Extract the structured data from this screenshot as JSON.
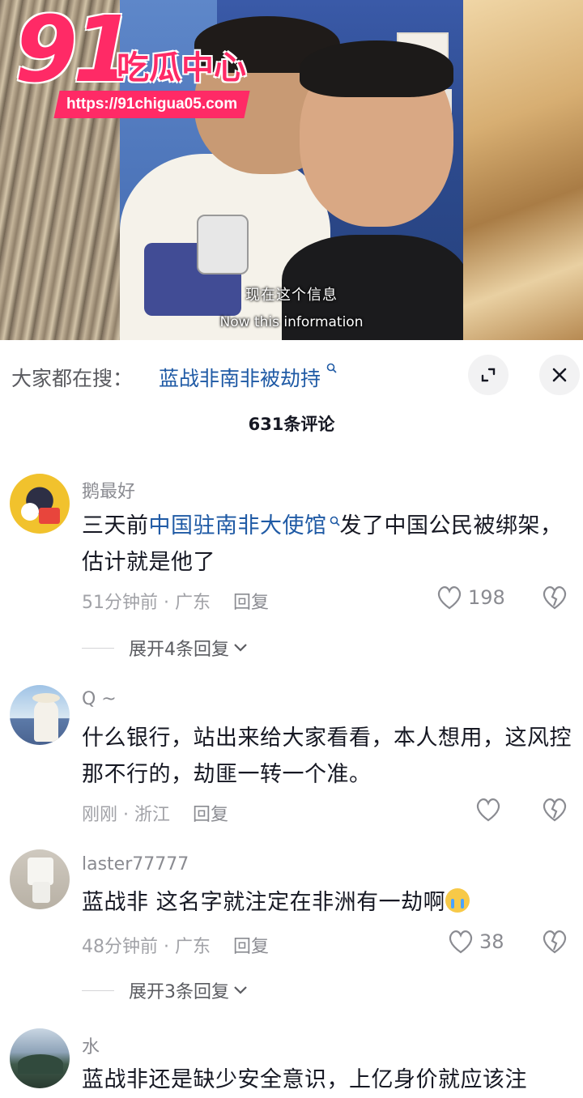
{
  "video": {
    "caption_cn": "现在这个信息",
    "caption_en": "Now this information"
  },
  "watermark": {
    "number": "91",
    "name": "吃瓜中心",
    "url": "https://91chigua05.com"
  },
  "search": {
    "prefix": "大家都在搜：",
    "term": "蓝战非南非被劫持"
  },
  "comments_header": {
    "count_label": "631条评论"
  },
  "comments": [
    {
      "username": "鹅最好",
      "text_before": "三天前",
      "link": "中国驻南非大使馆",
      "text_after": "发了中国公民被绑架，估计就是他了",
      "time": "51分钟前",
      "region": "广东",
      "reply_label": "回复",
      "likes": "198",
      "expand_label": "展开4条回复"
    },
    {
      "username": "Q ~",
      "text": "什么银行，站出来给大家看看，本人想用，这风控那不行的，劫匪一转一个准。",
      "time": "刚刚",
      "region": "浙江",
      "reply_label": "回复",
      "likes": ""
    },
    {
      "username": "laster77777",
      "text": "蓝战非 这名字就注定在非洲有一劫啊",
      "time": "48分钟前",
      "region": "广东",
      "reply_label": "回复",
      "likes": "38",
      "expand_label": "展开3条回复"
    },
    {
      "username": "水",
      "text": "蓝战非还是缺少安全意识，上亿身价就应该注"
    }
  ],
  "icons": {
    "search_glyph": "search-icon",
    "expand": "fullscreen-icon",
    "close": "close-icon",
    "like": "heart-outline-icon",
    "dislike": "broken-heart-icon",
    "chevron": "chevron-down-icon"
  },
  "colors": {
    "link": "#1f5aa5",
    "watermark": "#ff2a66",
    "muted": "#a1a2a7"
  }
}
